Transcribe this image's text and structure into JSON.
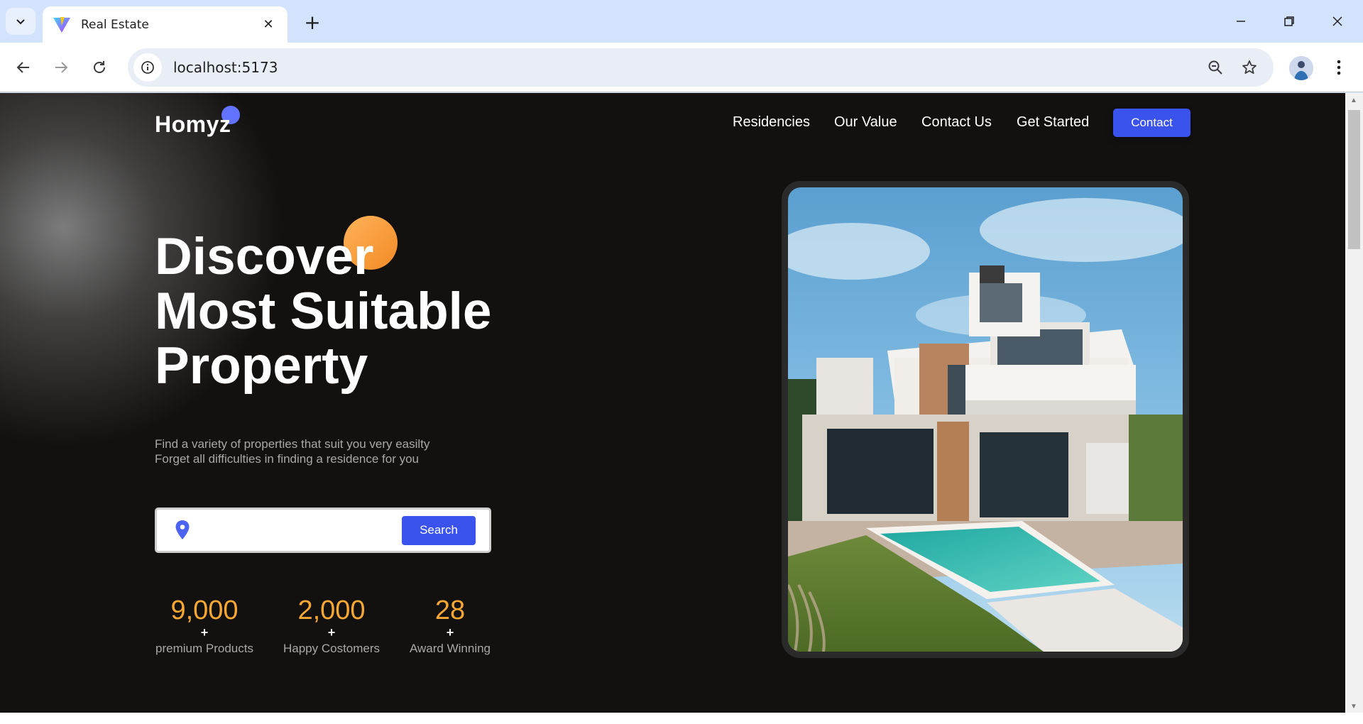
{
  "browser": {
    "tab_title": "Real Estate",
    "url": "localhost:5173",
    "new_tab_symbol": "+",
    "close_symbol": "✕"
  },
  "page": {
    "logo": "Homyz",
    "nav": [
      "Residencies",
      "Our Value",
      "Contact Us",
      "Get Started"
    ],
    "contact_button": "Contact",
    "hero_lines": [
      "Discover",
      "Most Suitable",
      "Property"
    ],
    "subtitle_lines": [
      "Find a variety of properties that suit you very easilty",
      "Forget all difficulties in finding a residence for you"
    ],
    "search": {
      "placeholder": "",
      "button": "Search"
    },
    "stats": [
      {
        "number": "9,000",
        "plus": "+",
        "label": "premium Products"
      },
      {
        "number": "2,000",
        "plus": "+",
        "label": "Happy Costomers"
      },
      {
        "number": "28",
        "plus": "+",
        "label": "Award Winning"
      }
    ]
  },
  "colors": {
    "accent_blue": "#3a53ec",
    "orange": "#f7a833",
    "background": "#131110"
  },
  "icons": [
    "chevron-down-icon",
    "vite-favicon-icon",
    "close-icon",
    "plus-icon",
    "minimize-icon",
    "restore-icon",
    "close-window-icon",
    "back-icon",
    "forward-icon",
    "reload-icon",
    "info-icon",
    "zoom-icon",
    "star-icon",
    "avatar",
    "more-menu-icon",
    "location-pin-icon"
  ]
}
